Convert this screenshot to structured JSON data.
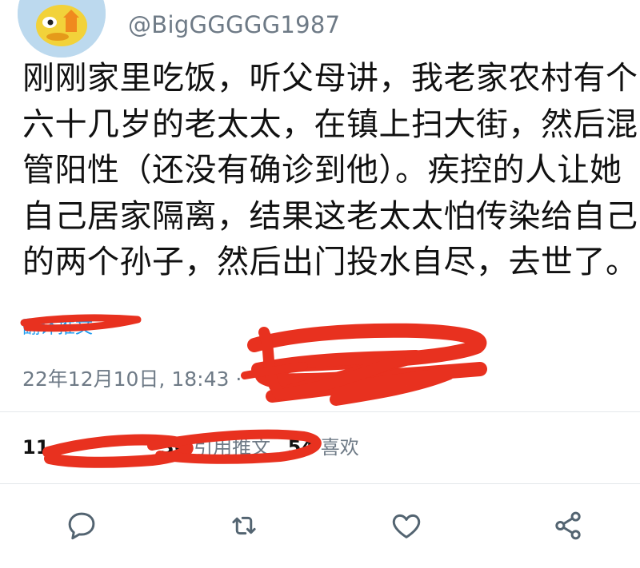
{
  "tweet": {
    "handle": "@BigGGGGG1987",
    "text_lines": [
      "刚刚家里吃饭，听父母讲，我老家农村有个",
      "六十几岁的老太太，在镇上扫大街，然后混",
      "管阳性（还没有确诊到他）。疾控的人让她",
      "自己居家隔离，结果这老太太怕传染给自己",
      "的两个孙子，然后出门投水自尽，去世了。"
    ],
    "translate_label": "翻译推文",
    "timestamp": "22年12月10日, 18:43 ·"
  },
  "stats": {
    "retweets_count": "11",
    "quotes_count": "36",
    "quotes_label": "引用推文",
    "likes_count": "54",
    "likes_label": "喜欢"
  },
  "actions": {
    "reply_icon": "reply-icon",
    "retweet_icon": "retweet-icon",
    "like_icon": "heart-icon",
    "share_icon": "share-icon"
  },
  "colors": {
    "text": "#111111",
    "secondary": "#6e7a86",
    "accent": "#1d9bf0",
    "redaction": "#e8311f",
    "avatar_bg": "#bcd9ee"
  }
}
